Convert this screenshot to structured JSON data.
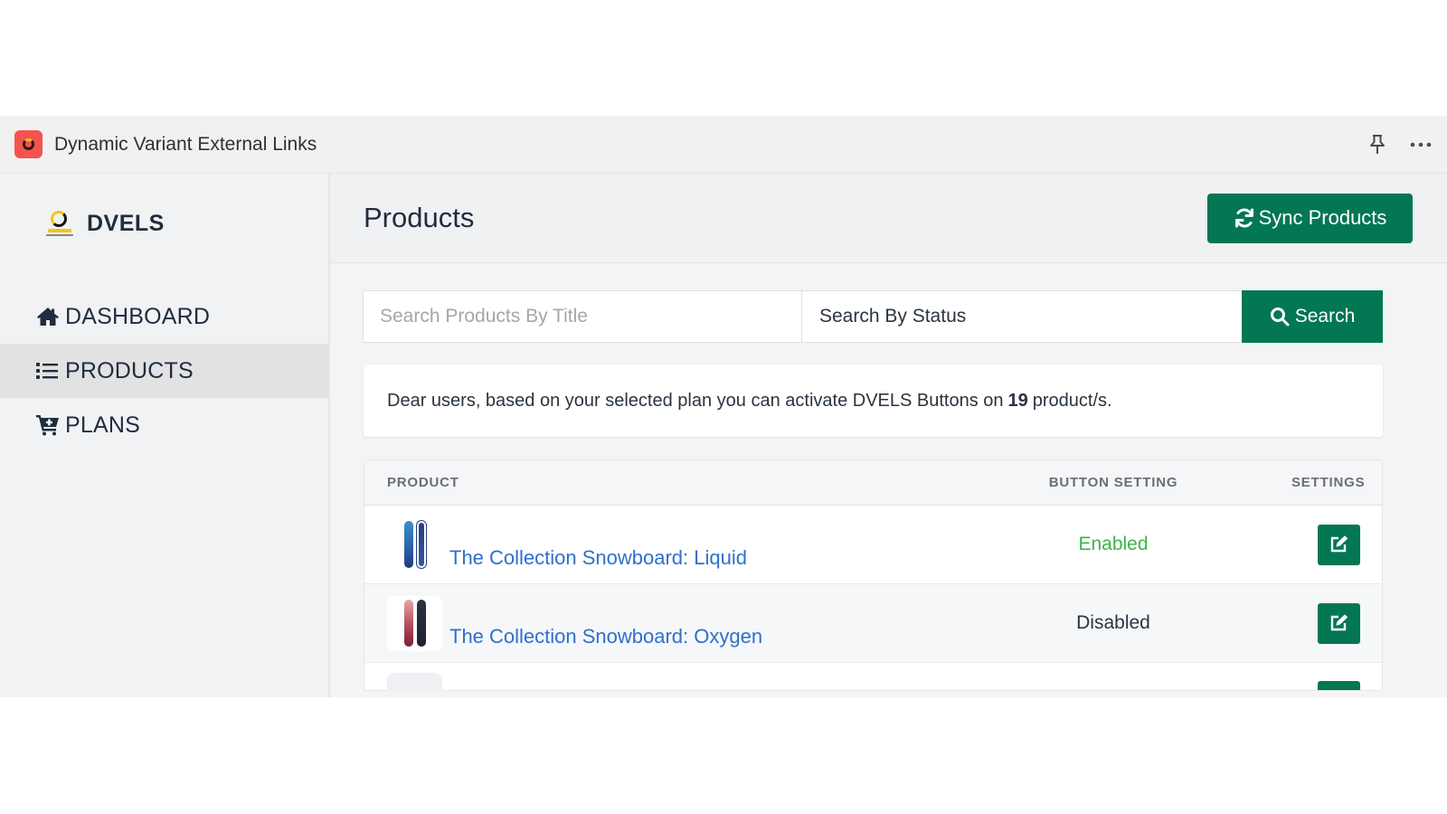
{
  "window": {
    "app_title": "Dynamic Variant External Links",
    "app_icon": "dvels-logo-icon",
    "actions": [
      {
        "name": "pin",
        "icon": "pin-icon"
      },
      {
        "name": "more",
        "icon": "more-horizontal-icon"
      }
    ]
  },
  "sidebar": {
    "brand": "DVELS",
    "items": [
      {
        "label": "DASHBOARD",
        "icon": "home-icon",
        "active": false
      },
      {
        "label": "PRODUCTS",
        "icon": "list-icon",
        "active": true
      },
      {
        "label": "PLANS",
        "icon": "cart-plus-icon",
        "active": false
      }
    ]
  },
  "header": {
    "title": "Products",
    "sync_label": "Sync Products"
  },
  "search": {
    "title_placeholder": "Search Products By Title",
    "title_value": "",
    "status_value": "Search By Status",
    "button_label": "Search"
  },
  "notice": {
    "prefix": "Dear users, based on your selected plan you can activate DVELS Buttons on",
    "count": "19",
    "suffix": "product/s."
  },
  "table": {
    "columns": [
      "PRODUCT",
      "BUTTON SETTING",
      "SETTINGS"
    ],
    "rows": [
      {
        "product": "The Collection Snowboard: Liquid",
        "status": "Enabled",
        "status_color": "#3db449"
      },
      {
        "product": "The Collection Snowboard: Oxygen",
        "status": "Disabled",
        "status_color": "#2a3440"
      }
    ]
  },
  "colors": {
    "accent": "#037754",
    "link": "#2f6fcb",
    "enabled": "#3db449",
    "app_icon_bg": "#f5534f"
  }
}
